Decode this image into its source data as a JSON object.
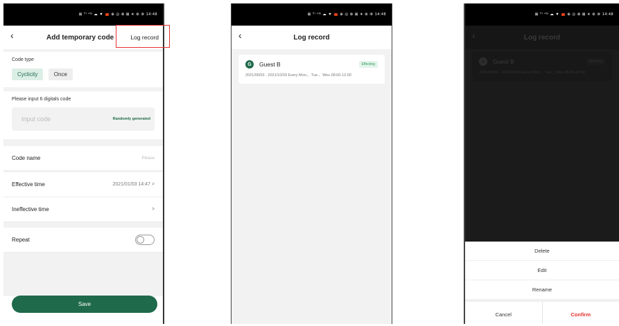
{
  "status_bar": {
    "left": "⊠ ᵀˡ ⁴ᴳ ☁ ▼",
    "right": "⊕ ◎ ⊗ ⊠ ∗ ⊛ ⑧ 14:48"
  },
  "screen1": {
    "title": "Add temporary code",
    "log_record_link": "Log record",
    "code_type_label": "Code type",
    "code_types": [
      "Cyclicity",
      "Once"
    ],
    "code_input_label": "Please input 6 digitals code",
    "code_input_placeholder": "Input code",
    "random_button": "Randomly generated",
    "rows": [
      {
        "label": "Code name",
        "value": "Please"
      },
      {
        "label": "Effective time",
        "value": "2021/01/03 14:47 >"
      },
      {
        "label": "Ineffective time",
        "value": ">"
      }
    ],
    "repeat_label": "Repeat",
    "save_button": "Save"
  },
  "screen2": {
    "title": "Log record",
    "entry": {
      "avatar": "G",
      "name": "Guest B",
      "status": "Effecting",
      "detail": "2021/05/03 - 2021/10/03 Every Mon.、Tue.、Wes 08:00-12:00"
    }
  },
  "screen3": {
    "title": "Log record",
    "entry": {
      "avatar": "G",
      "name": "Guest B",
      "status": "Effecting",
      "detail": "2021/05/03 - 2021/10/03 Every Mon.、Tue.、Wes 08:00-12:00"
    },
    "sheet_options": [
      "Delete",
      "Edit",
      "Rename"
    ],
    "cancel": "Cancel",
    "confirm": "Confirm"
  },
  "colors": {
    "accent": "#1e6a4a",
    "danger": "#e3302f",
    "highlight": "#e3302f"
  }
}
